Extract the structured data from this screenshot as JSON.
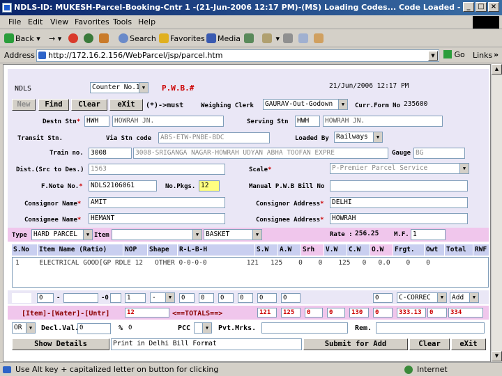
{
  "window": {
    "title": "NDLS-ID: MUKESH-Parcel-Booking-Cntr 1 -(21-Jun-2006 12:17 PM)-(MS) Loading Codes... Code Loaded - Microsoft Internet Ex...",
    "min": "_",
    "max": "□",
    "close": "×"
  },
  "menubar": {
    "file": "File",
    "edit": "Edit",
    "view": "View",
    "favorites": "Favorites",
    "tools": "Tools",
    "help": "Help"
  },
  "toolbar": {
    "back": "Back",
    "forward_arrow": "→",
    "search": "Search",
    "favorites": "Favorites",
    "media": "Media"
  },
  "addressbar": {
    "label": "Address",
    "url": "http://172.16.2.156/WebParcel/jsp/parcel.htm",
    "go": "Go",
    "links": "Links",
    "more": "»"
  },
  "form": {
    "station": "NDLS",
    "counter": "Counter No.1",
    "pwb_label": "P.W.B.#",
    "datetime": "21/Jun/2006 12:17 PM",
    "buttons": {
      "new": "New",
      "find": "Find",
      "clear": "Clear",
      "exit": "eXit"
    },
    "must_note": "(*)->must",
    "weighing_clerk_label": "Weighing Clerk",
    "weighing_clerk": "GAURAV-Out-Godown",
    "curr_form_label": "Curr.Form No",
    "curr_form": "235600",
    "destn_label": "Destn Stn",
    "destn_code": "HWH",
    "destn_name": "HOWRAH JN.",
    "serving_label": "Serving Stn",
    "serving_code": "HWH",
    "serving_name": "HOWRAH JN.",
    "transit_label": "Transit Stn.",
    "via_label": "Via Stn code",
    "via_value": "ABS-ETW-PNBE-BDC",
    "loaded_by_label": "Loaded By",
    "loaded_by": "Railways",
    "train_label": "Train no.",
    "train_no": "3008",
    "train_name": "3008-SRIGANGA NAGAR-HOWRAH UDYAN ABHA TOOFAN EXPRE",
    "gauge_label": "Gauge",
    "gauge": "BG",
    "dist_label": "Dist.(Src to Des.)",
    "dist": "1563",
    "scale_label": "Scale",
    "scale": "P-Premier Parcel Service",
    "fnote_label": "F.Note No.",
    "fnote": "NDLS2106061",
    "nopkgs_label": "No.Pkgs.",
    "nopkgs": "12",
    "manual_pwb_label": "Manual P.W.B Bill No",
    "consignor_name_label": "Consignor Name",
    "consignor_name": "AMIT",
    "consignor_addr_label": "Consignor Address",
    "consignor_addr": "DELHI",
    "consignee_name_label": "Consignee Name",
    "consignee_name": "HEMANT",
    "consignee_addr_label": "Consignee Address",
    "consignee_addr": "HOWRAH",
    "type_label": "Type",
    "type": "HARD PARCEL",
    "item_label": "Item",
    "packing": "BASKET",
    "rate_label": "Rate :",
    "rate": "256.25",
    "mf_label": "M.F.",
    "mf": "1",
    "table_headers": [
      "S.No",
      "Item Name (Ratio)",
      "NOP",
      "Shape",
      "R-L-B-H",
      "S.W",
      "A.W",
      "Srh",
      "V.W",
      "C.W",
      "O.W",
      "Frgt.",
      "Owt",
      "Total",
      "RWF"
    ],
    "table_row": "1     ELECTRICAL GOOD[GP RDLE 12   OTHER 0-0-0-0          121   125    0    0    125   0   0.0    0    0",
    "entry": {
      "f1": "0",
      "dash1": "-",
      "f2": "0",
      "dash2": "-0",
      "f3": "1",
      "sel_symbol": "-",
      "f4": "0",
      "f5": "0",
      "f6": "0",
      "f7": "0",
      "f8": "0",
      "f9": "0",
      "f10": "0",
      "correction": "C-CORREC",
      "add": "Add"
    },
    "totals": {
      "item_water_label": "[Item]-[Water]-[Untr]",
      "count": "12",
      "totals_label": "<==TOTALS==>",
      "t1": "121",
      "t2": "125",
      "t3": "0",
      "t4": "0",
      "t5": "130",
      "t6": "0",
      "frgt": "333.13",
      "t7": "0",
      "grand": "334"
    },
    "bottom": {
      "or": "OR",
      "decl_label": "Decl.Val.",
      "decl": "0",
      "pct_label": "%",
      "pct": "0",
      "pcc_label": "PCC",
      "pvt_label": "Pvt.Mrks.",
      "rem_label": "Rem.",
      "show_details": "Show Details",
      "print_option": "Print in Delhi Bill Format",
      "submit": "Submit for Add",
      "clear": "Clear",
      "exit": "eXit"
    }
  },
  "statusbar": {
    "hint": "Use Alt key + capitalized letter on button for clicking",
    "zone": "Internet"
  },
  "colors": {
    "title_start": "#0a246a",
    "panel_lavender": "#eae7f6",
    "panel_pink": "#f0c6ec",
    "required_red": "#cc0000"
  }
}
